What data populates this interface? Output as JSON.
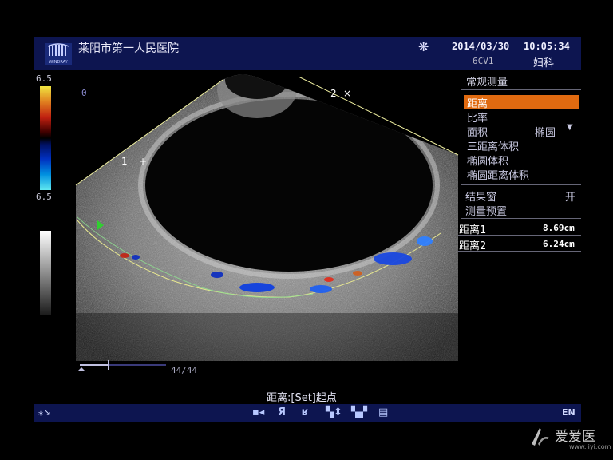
{
  "header": {
    "hospital": "莱阳市第一人民医院",
    "logo_text": "WINDRAY",
    "freeze_icon": "snowflake-icon",
    "date": "2014/03/30",
    "time": "10:05:34",
    "probe": "6CV1",
    "department": "妇科"
  },
  "scales": {
    "color_top": "6.5",
    "color_bottom": "6.5"
  },
  "image": {
    "depth_zero": "0",
    "caliper1": "1",
    "caliper2": "2"
  },
  "menu": {
    "title": "常规测量",
    "items": [
      {
        "label": "距离",
        "selected": true
      },
      {
        "label": "比率"
      },
      {
        "label": "面积",
        "option": "椭圆"
      },
      {
        "label": "三距离体积"
      },
      {
        "label": "椭圆体积"
      },
      {
        "label": "椭圆距离体积"
      }
    ],
    "result_window_label": "结果窗",
    "result_window_value": "开",
    "preset_label": "测量预置"
  },
  "results": [
    {
      "label": "距离1",
      "value": "8.69cm"
    },
    {
      "label": "距离2",
      "value": "6.24cm"
    }
  ],
  "cine": {
    "frames": "44/44"
  },
  "prompt": "距离:[Set]起点",
  "footer": {
    "language": "EN",
    "toolbar_glyph_1": "Я",
    "toolbar_glyph_2": "ʁ"
  },
  "watermark": {
    "text": "爱爱医",
    "url": "www.iiyi.com"
  },
  "colors": {
    "header_bg": "#0d1550",
    "selection": "#e06a10",
    "caliper": "#e8e890"
  }
}
